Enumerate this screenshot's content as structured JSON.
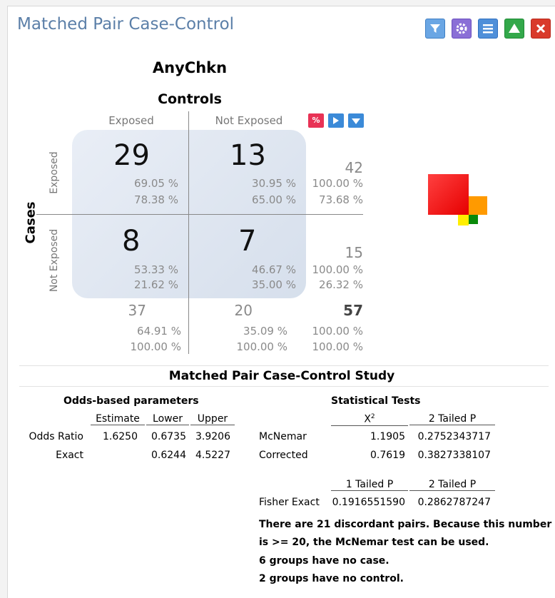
{
  "window": {
    "title": "Matched Pair Case-Control"
  },
  "toolbar": {
    "icons": [
      "filter-icon",
      "gear-icon",
      "menu-icon",
      "up-triangle-icon",
      "close-icon"
    ]
  },
  "table": {
    "variable": "AnyChkn",
    "controls_label": "Controls",
    "cases_label": "Cases",
    "col_headers": [
      "Exposed",
      "Not Exposed"
    ],
    "row_headers": [
      "Exposed",
      "Not Exposed"
    ],
    "cells": [
      {
        "count": "29",
        "row_pct": "69.05 %",
        "col_pct": "78.38 %"
      },
      {
        "count": "13",
        "row_pct": "30.95 %",
        "col_pct": "65.00 %"
      },
      {
        "count": "8",
        "row_pct": "53.33 %",
        "col_pct": "21.62 %"
      },
      {
        "count": "7",
        "row_pct": "46.67 %",
        "col_pct": "35.00 %"
      }
    ],
    "row_totals": [
      {
        "count": "42",
        "row_pct": "100.00 %",
        "col_pct": "73.68 %"
      },
      {
        "count": "15",
        "row_pct": "100.00 %",
        "col_pct": "26.32 %"
      }
    ],
    "col_totals": [
      {
        "count": "37",
        "row_pct": "64.91 %",
        "col_pct": "100.00 %"
      },
      {
        "count": "20",
        "row_pct": "35.09 %",
        "col_pct": "100.00 %"
      }
    ],
    "grand_total": {
      "count": "57",
      "row_pct": "100.00 %",
      "col_pct": "100.00 %"
    },
    "mini_buttons": {
      "percent_label": "%"
    }
  },
  "study": {
    "title": "Matched Pair Case-Control Study",
    "odds": {
      "heading": "Odds-based parameters",
      "cols": [
        "Estimate",
        "Lower",
        "Upper"
      ],
      "rows": [
        {
          "label": "Odds Ratio",
          "estimate": "1.6250",
          "lower": "0.6735",
          "upper": "3.9206"
        },
        {
          "label": "Exact",
          "estimate": "",
          "lower": "0.6244",
          "upper": "4.5227"
        }
      ]
    },
    "stats": {
      "heading": "Statistical Tests",
      "cols": [
        "X",
        "2",
        "2 Tailed P"
      ],
      "rows": [
        {
          "label": "McNemar",
          "x2": "1.1905",
          "p2": "0.2752343717"
        },
        {
          "label": "Corrected",
          "x2": "0.7619",
          "p2": "0.3827338107"
        }
      ],
      "fisher_cols": [
        "1 Tailed P",
        "2 Tailed P"
      ],
      "fisher": {
        "label": "Fisher Exact",
        "p1": "0.1916551590",
        "p2": "0.2862787247"
      }
    },
    "notes": [
      "There are 21 discordant pairs.  Because this number",
      "is  >= 20, the McNemar test can be used.",
      "6 groups have no case.",
      "2 groups have no control."
    ]
  },
  "colors": {
    "title": "#5b7fa8",
    "red": "#ff1e1e",
    "orange": "#ff9a00",
    "yellow": "#ffee00",
    "green": "#0a8a0a"
  }
}
